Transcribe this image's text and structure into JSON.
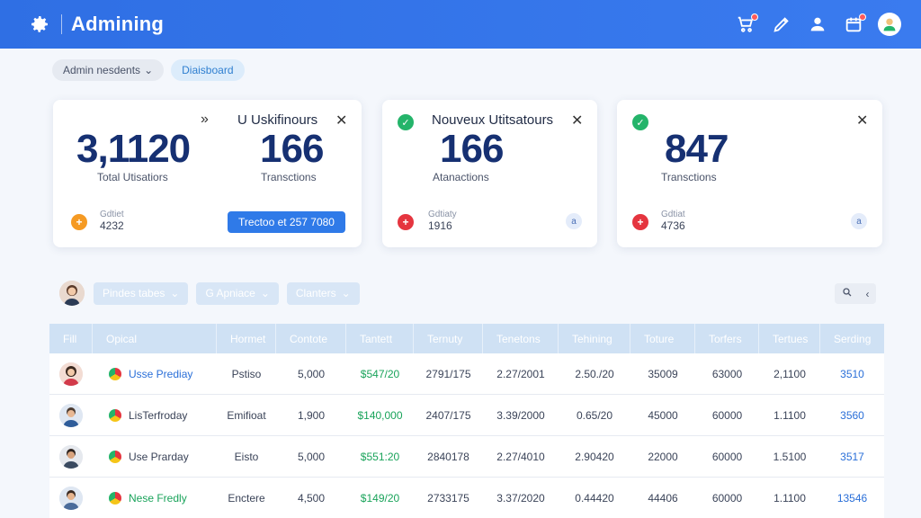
{
  "header": {
    "app_title": "Admining",
    "icons": [
      "gear-icon",
      "cart-icon",
      "pen-icon",
      "user-icon",
      "calendar-icon",
      "avatar"
    ]
  },
  "breadcrumb": {
    "items": [
      {
        "label": "Admin nesdents",
        "chevron": "⌄"
      },
      {
        "label": "Diaisboard"
      }
    ]
  },
  "cards": {
    "card1": {
      "big_value": "3,1120",
      "big_label": "Total Utisatiors",
      "title": "U Uskifinours",
      "arrows": "»",
      "second_value": "166",
      "second_label": "Transctions",
      "sub_label": "Gdtiet",
      "sub_value": "4232",
      "cta_label": "Trectoo et 257 7080"
    },
    "card2": {
      "title": "Nouveux Utitsatours",
      "value": "166",
      "label": "Atanactions",
      "sub_label": "Gdtiaty",
      "sub_value": "1916",
      "badge": "a"
    },
    "card3": {
      "value": "847",
      "label": "Transctions",
      "sub_label": "Gdtiat",
      "sub_value": "4736",
      "badge": "a"
    }
  },
  "filters": {
    "pills": [
      {
        "label": "Pindes tabes",
        "chevron": "⌄"
      },
      {
        "label": "G Apniace",
        "chevron": "⌄"
      },
      {
        "label": "Clanters",
        "chevron": "⌄"
      }
    ]
  },
  "table": {
    "columns": [
      "Fill",
      "Opical",
      "Hormet",
      "Contote",
      "Tantett",
      "Ternuty",
      "Tenetons",
      "Tehining",
      "Toture",
      "Torfers",
      "Tertues",
      "Serding"
    ],
    "rows": [
      {
        "name": "Usse Prediay",
        "hormet": "Pstiso",
        "contote": "5,000",
        "tantett": "$547/20",
        "ternuty": "2791/175",
        "tenetons": "2.27/2001",
        "tehining": "2.50./20",
        "toture": "35009",
        "torfers": "63000",
        "tertues": "2,1100",
        "serding": "3510"
      },
      {
        "name": "LisTerfroday",
        "hormet": "Emifioat",
        "contote": "1,900",
        "tantett": "$140,000",
        "ternuty": "2407/175",
        "tenetons": "3.39/2000",
        "tehining": "0.65/20",
        "toture": "45000",
        "torfers": "60000",
        "tertues": "1.1100",
        "serding": "3560"
      },
      {
        "name": "Use Prarday",
        "hormet": "Eisto",
        "contote": "5,000",
        "tantett": "$551:20",
        "ternuty": "2840178",
        "tenetons": "2.27/4010",
        "tehining": "2.90420",
        "toture": "22000",
        "torfers": "60000",
        "tertues": "1.5100",
        "serding": "3517"
      },
      {
        "name": "Nese Fredly",
        "hormet": "Enctere",
        "contote": "4,500",
        "tantett": "$149/20",
        "ternuty": "2733175",
        "tenetons": "3.37/2020",
        "tehining": "0.44420",
        "toture": "44406",
        "torfers": "60000",
        "tertues": "1.1100",
        "serding": "13546"
      }
    ]
  },
  "colors": {
    "header_bg": "#2f6fe4",
    "accent_blue": "#2f7ae8",
    "positive_green": "#19a35a",
    "alert_red": "#e5353f",
    "table_header_bg": "#cfe1f4"
  }
}
